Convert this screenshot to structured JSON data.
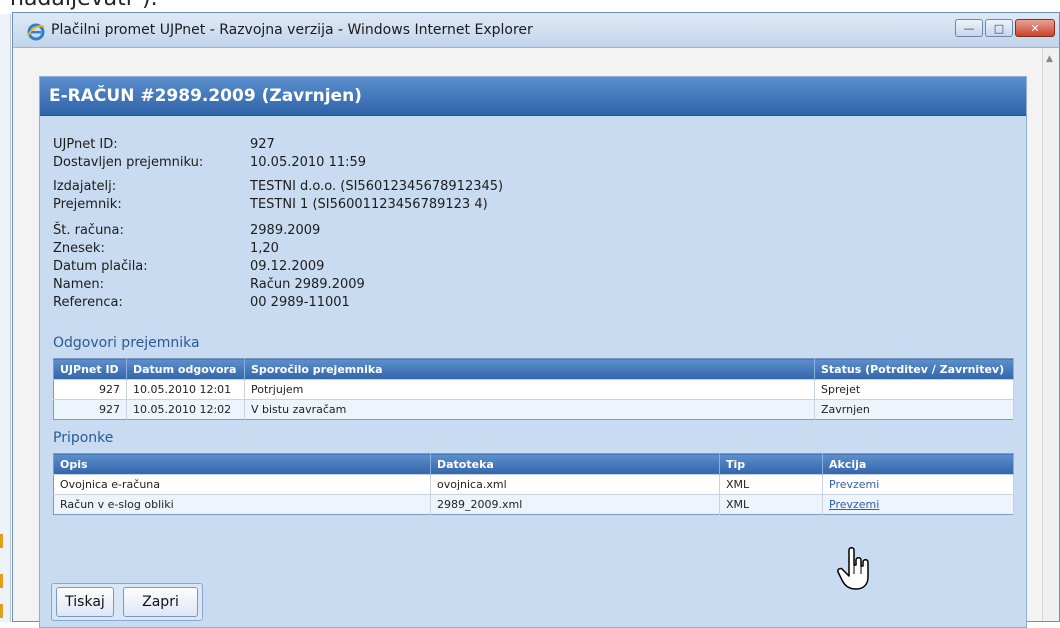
{
  "caption": {
    "text": "nadaljevati\")."
  },
  "window": {
    "title": "Plačilni promet UJPnet - Razvojna verzija - Windows Internet Explorer",
    "buttons": [
      "minimize-icon",
      "maximize-icon",
      "close-icon"
    ]
  },
  "dialog": {
    "title": "E-RAČUN #2989.2009 (Zavrnjen)",
    "fields": [
      {
        "label": "UJPnet ID:",
        "value": "927"
      },
      {
        "label": "Dostavljen prejemniku:",
        "value": "10.05.2010 11:59"
      },
      {
        "label": "Izdajatelj:",
        "value": "TESTNI d.o.o. (SI56012345678912345)"
      },
      {
        "label": "Prejemnik:",
        "value": "TESTNI 1 (SI56001123456789123 4)"
      },
      {
        "label": "Št. računa:",
        "value": "2989.2009"
      },
      {
        "label": "Znesek:",
        "value": "1,20"
      },
      {
        "label": "Datum plačila:",
        "value": "09.12.2009"
      },
      {
        "label": "Namen:",
        "value": "Račun 2989.2009"
      },
      {
        "label": "Referenca:",
        "value": "00 2989-11001"
      }
    ],
    "responses": {
      "title": "Odgovori prejemnika",
      "headers": [
        "UJPnet ID",
        "Datum odgovora",
        "Sporočilo prejemnika",
        "Status (Potrditev / Zavrnitev)"
      ],
      "rows": [
        [
          "927",
          "10.05.2010 12:01",
          "Potrjujem",
          "Sprejet"
        ],
        [
          "927",
          "10.05.2010 12:02",
          "V bistu zavračam",
          "Zavrnjen"
        ]
      ]
    },
    "attachments": {
      "title": "Priponke",
      "headers": [
        "Opis",
        "Datoteka",
        "Tip",
        "Akcija"
      ],
      "rows": [
        [
          "Ovojnica e-računa",
          "ovojnica.xml",
          "XML",
          "Prevzemi"
        ],
        [
          "Račun v e-slog obliki",
          "2989_2009.xml",
          "XML",
          "Prevzemi"
        ]
      ]
    },
    "buttons": {
      "print": "Tiskaj",
      "close": "Zapri"
    }
  }
}
